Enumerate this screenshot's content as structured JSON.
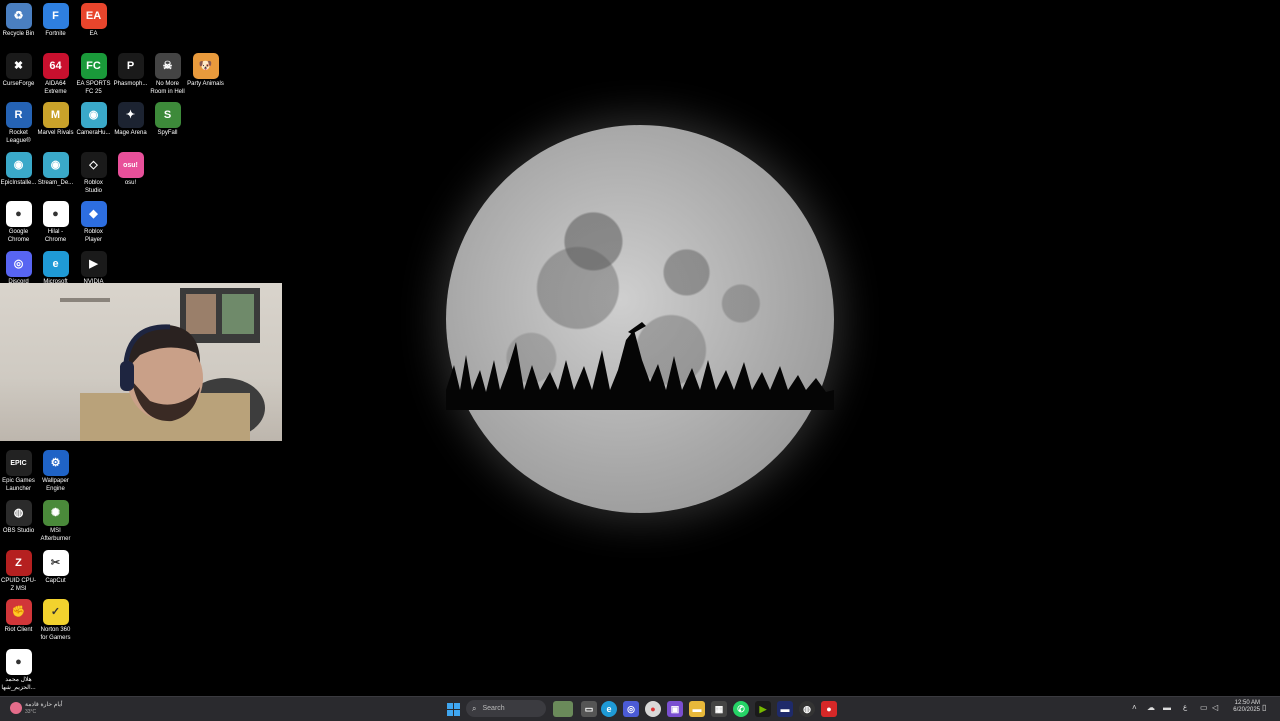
{
  "desktop_icons": [
    {
      "label": "Recycle Bin",
      "icon": "recycle-bin-icon",
      "color": "#4a7fc1",
      "glyph": "♻"
    },
    {
      "label": "Fortnite",
      "icon": "fortnite-icon",
      "color": "#2e7fe0",
      "glyph": "F"
    },
    {
      "label": "EA",
      "icon": "ea-icon",
      "color": "#e8452c",
      "glyph": "EA"
    },
    {
      "label": "CurseForge",
      "icon": "curseforge-icon",
      "color": "#1a1a1a",
      "glyph": "✖"
    },
    {
      "label": "AIDA64 Extreme",
      "icon": "aida64-icon",
      "color": "#c8102e",
      "glyph": "64"
    },
    {
      "label": "EA SPORTS FC 25",
      "icon": "ea-sports-fc-icon",
      "color": "#1a9a3a",
      "glyph": "FC"
    },
    {
      "label": "Phasmoph...",
      "icon": "phasmophobia-icon",
      "color": "#1a1a1a",
      "glyph": "P"
    },
    {
      "label": "No More Room in Hell",
      "icon": "no-more-room-in-hell-icon",
      "color": "#444",
      "glyph": "☠"
    },
    {
      "label": "Party Animals",
      "icon": "party-animals-icon",
      "color": "#e89a3c",
      "glyph": "🐶"
    },
    {
      "label": "Rocket League®",
      "icon": "rocket-league-icon",
      "color": "#2563b5",
      "glyph": "R"
    },
    {
      "label": "Marvel Rivals",
      "icon": "marvel-rivals-icon",
      "color": "#c9a22a",
      "glyph": "M"
    },
    {
      "label": "CameraHu...",
      "icon": "camerahub-icon",
      "color": "#3aa9c9",
      "glyph": "◉"
    },
    {
      "label": "Mage Arena",
      "icon": "mage-arena-icon",
      "color": "#1c2331",
      "glyph": "✦"
    },
    {
      "label": "SpyFall",
      "icon": "spyfall-icon",
      "color": "#3d8a3a",
      "glyph": "S"
    },
    {
      "label": "EpicInstalle...",
      "icon": "epic-installer-icon",
      "color": "#3aa9c9",
      "glyph": "◉"
    },
    {
      "label": "Stream_De...",
      "icon": "stream-deck-icon",
      "color": "#3aa9c9",
      "glyph": "◉"
    },
    {
      "label": "Roblox Studio",
      "icon": "roblox-studio-icon",
      "color": "#1a1a1a",
      "glyph": "◇"
    },
    {
      "label": "osu!",
      "icon": "osu-icon",
      "color": "#e8509a",
      "glyph": "osu!"
    },
    {
      "label": "Google Chrome",
      "icon": "chrome-icon",
      "color": "#ffffff",
      "glyph": "●"
    },
    {
      "label": "Hilal - Chrome",
      "icon": "chrome-profile-icon",
      "color": "#ffffff",
      "glyph": "●"
    },
    {
      "label": "Roblox Player",
      "icon": "roblox-player-icon",
      "color": "#2d6ee0",
      "glyph": "◆"
    },
    {
      "label": "Discord",
      "icon": "discord-icon",
      "color": "#5865f2",
      "glyph": "◎"
    },
    {
      "label": "Microsoft",
      "icon": "edge-icon",
      "color": "#1f9ad6",
      "glyph": "e"
    },
    {
      "label": "NVIDIA",
      "icon": "nvidia-icon",
      "color": "#1a1a1a",
      "glyph": "▶"
    },
    {
      "label": "Epic Games Launcher",
      "icon": "epic-games-icon",
      "color": "#222",
      "glyph": "EPIC"
    },
    {
      "label": "Wallpaper Engine",
      "icon": "wallpaper-engine-icon",
      "color": "#1f63c6",
      "glyph": "⚙"
    },
    {
      "label": "OBS Studio",
      "icon": "obs-icon",
      "color": "#2b2b2b",
      "glyph": "◍"
    },
    {
      "label": "MSI Afterburner",
      "icon": "msi-afterburner-icon",
      "color": "#4a8a3a",
      "glyph": "✺"
    },
    {
      "label": "CPUID CPU-Z MSI",
      "icon": "cpuz-icon",
      "color": "#b52020",
      "glyph": "Z"
    },
    {
      "label": "CapCut",
      "icon": "capcut-icon",
      "color": "#ffffff",
      "glyph": "✂"
    },
    {
      "label": "Riot Client",
      "icon": "riot-client-icon",
      "color": "#d13639",
      "glyph": "✊"
    },
    {
      "label": "Norton 360 for Gamers",
      "icon": "norton-icon",
      "color": "#f2d22e",
      "glyph": "✓"
    },
    {
      "label": "هلال محمد الحزيم_شها...",
      "icon": "chrome-shortcut-icon",
      "color": "#ffffff",
      "glyph": "●"
    }
  ],
  "taskbar": {
    "weather_text": "أيام حارة قادمة",
    "weather_temp": "33°C",
    "search_placeholder": "Search",
    "time": "12:50 AM",
    "date": "6/20/2025"
  },
  "colors": {
    "taskbar_bg": "#2a2a2e",
    "desktop_bg": "#000000"
  }
}
